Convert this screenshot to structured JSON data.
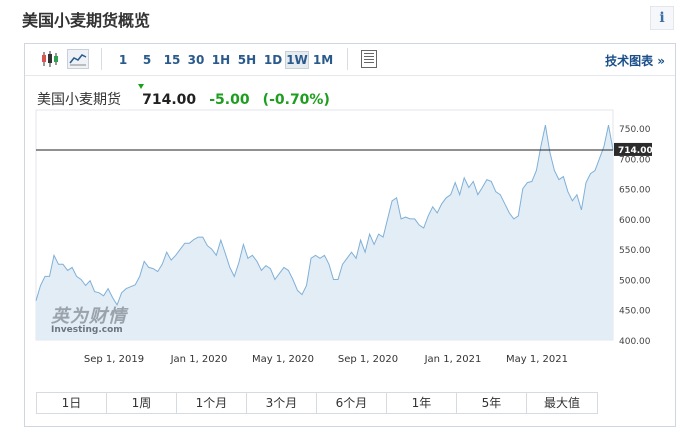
{
  "header": {
    "title": "美国小麦期货概览",
    "info_label": "i"
  },
  "toolbar": {
    "periods": [
      "1",
      "5",
      "15",
      "30",
      "1H",
      "5H",
      "1D",
      "1W",
      "1M"
    ],
    "active_period": "1W",
    "tech_chart_label": "技术图表 »"
  },
  "quote": {
    "name": "美国小麦期货",
    "price": "714.00",
    "change": "-5.00",
    "change_pct": "(-0.70%)",
    "change_color": "#1e9e1e"
  },
  "watermark": {
    "cn": "英为财情",
    "en": "Investing.com"
  },
  "ranges": [
    "1日",
    "1周",
    "1个月",
    "3个月",
    "6个月",
    "1年",
    "5年",
    "最大值"
  ],
  "chart_data": {
    "type": "area",
    "x_tick_labels": [
      "Sep 1, 2019",
      "Jan 1, 2020",
      "May 1, 2020",
      "Sep 1, 2020",
      "Jan 1, 2021",
      "May 1, 2021"
    ],
    "y_tick_labels": [
      "750.00",
      "700.00",
      "650.00",
      "600.00",
      "550.00",
      "500.00",
      "450.00",
      "400.00"
    ],
    "ylim": [
      400,
      780
    ],
    "current_value": 714.0,
    "current_label": "714.00",
    "line_color": "#7fb0d8",
    "fill_color": "#e3edf5",
    "values": [
      465,
      490,
      505,
      505,
      540,
      525,
      525,
      515,
      520,
      505,
      500,
      490,
      498,
      480,
      478,
      473,
      485,
      470,
      458,
      478,
      485,
      488,
      491,
      505,
      530,
      520,
      518,
      513,
      525,
      545,
      532,
      540,
      550,
      560,
      560,
      566,
      570,
      570,
      556,
      550,
      540,
      565,
      543,
      520,
      505,
      528,
      558,
      535,
      540,
      530,
      515,
      523,
      518,
      500,
      510,
      520,
      515,
      500,
      482,
      475,
      490,
      535,
      540,
      535,
      540,
      525,
      500,
      500,
      525,
      535,
      545,
      535,
      565,
      545,
      575,
      558,
      575,
      570,
      600,
      630,
      635,
      600,
      603,
      600,
      600,
      590,
      585,
      605,
      620,
      610,
      625,
      635,
      640,
      660,
      640,
      668,
      652,
      662,
      640,
      652,
      665,
      662,
      645,
      640,
      625,
      610,
      600,
      605,
      650,
      660,
      662,
      680,
      720,
      755,
      710,
      680,
      665,
      670,
      645,
      630,
      640,
      615,
      660,
      675,
      680,
      700,
      720,
      755,
      714
    ]
  }
}
